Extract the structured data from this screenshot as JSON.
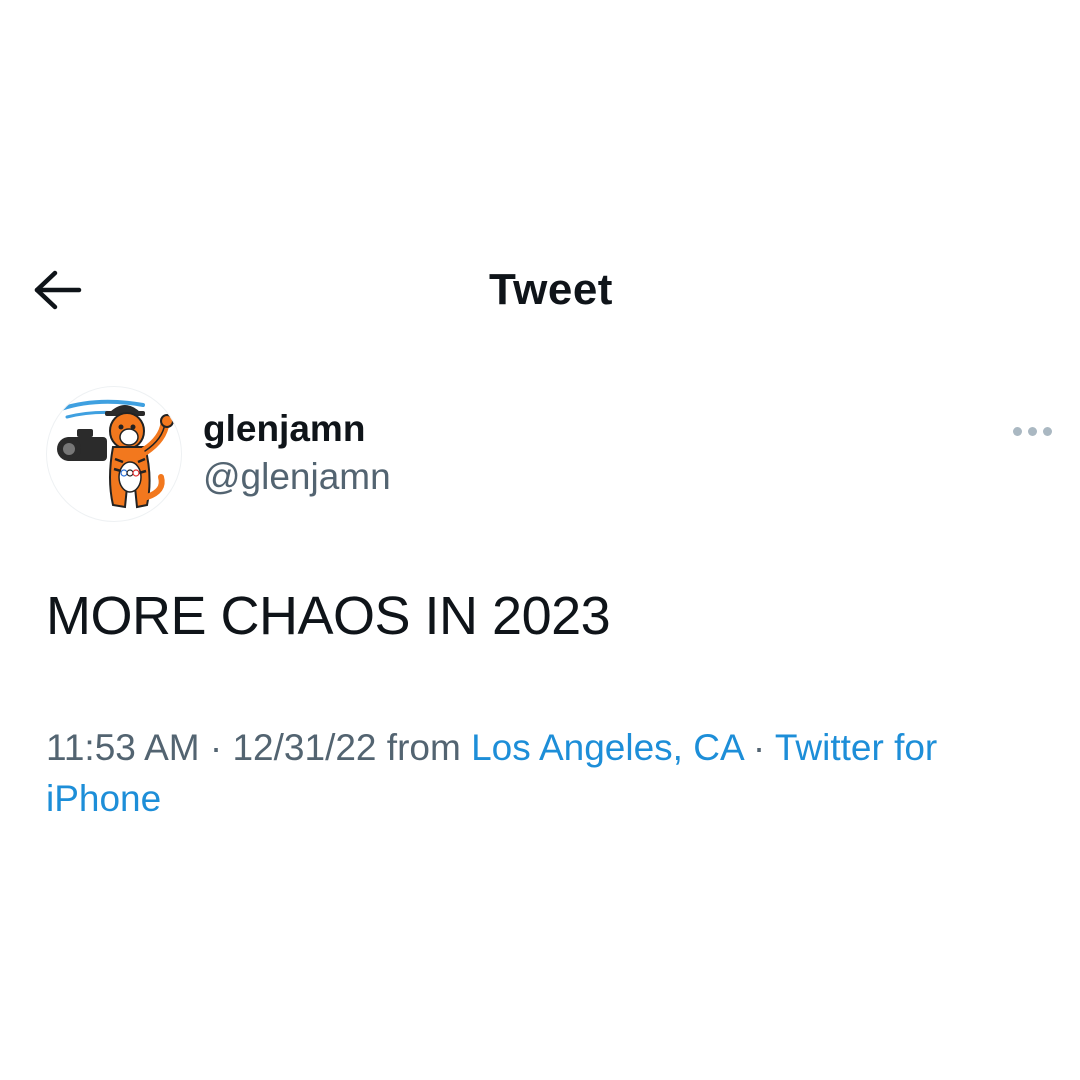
{
  "header": {
    "title": "Tweet",
    "back_icon": "arrow-left-icon"
  },
  "author": {
    "display_name": "glenjamn",
    "handle": "@glenjamn",
    "avatar_icon": "tiger-mascot-avatar"
  },
  "more_icon": "more-horizontal-icon",
  "tweet": {
    "text": "MORE CHAOS IN 2023"
  },
  "meta": {
    "time": "11:53 AM",
    "sep1": " · ",
    "date": "12/31/22",
    "from_word": " from ",
    "location": "Los Angeles, CA",
    "sep2": " · ",
    "source": "Twitter for iPhone"
  },
  "colors": {
    "link": "#1d8ed8",
    "secondary_text": "#536471",
    "primary_text": "#0f1419",
    "tiger_orange": "#f2781e"
  }
}
